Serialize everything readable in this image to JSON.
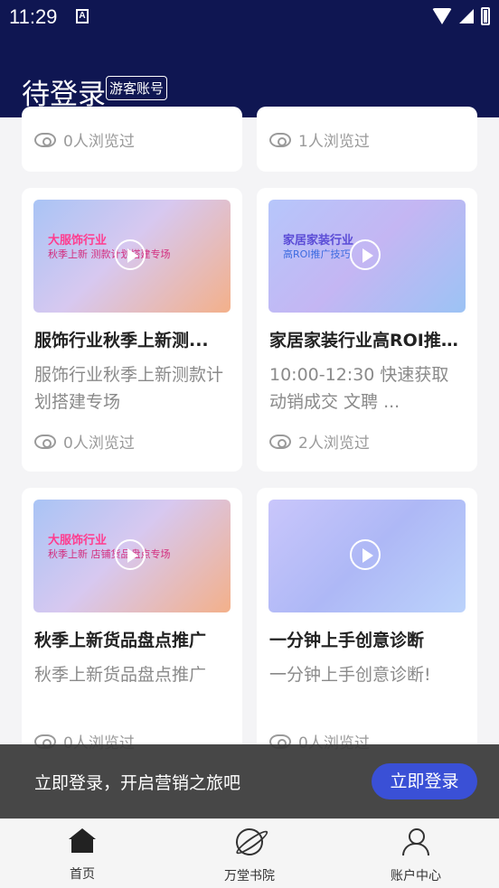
{
  "status_bar": {
    "time": "11:29",
    "a_label": "A"
  },
  "header": {
    "title": "待登录",
    "badge": "游客账号"
  },
  "top_row": [
    {
      "views": "0人浏览过"
    },
    {
      "views": "1人浏览过"
    }
  ],
  "cards": [
    {
      "thumb_line1": "大服饰行业",
      "thumb_line2": "秋季上新 测款计划搭建专场",
      "title": "服饰行业秋季上新测...",
      "desc": "服饰行业秋季上新测款计划搭建专场",
      "views": "0人浏览过"
    },
    {
      "thumb_line1": "家居家装行业",
      "thumb_line2": "高ROI推广技巧",
      "title": "家居家装行业高ROI推...",
      "desc": "10:00-12:30 快速获取动销成交 文聘 ...",
      "views": "2人浏览过"
    },
    {
      "thumb_line1": "大服饰行业",
      "thumb_line2": "秋季上新 店铺货品盘点专场",
      "title": "秋季上新货品盘点推广",
      "desc": "秋季上新货品盘点推广",
      "views": "0人浏览过"
    },
    {
      "thumb_line1": "",
      "thumb_line2": "",
      "title": "一分钟上手创意诊断",
      "desc": "一分钟上手创意诊断!",
      "views": "0人浏览过"
    }
  ],
  "login_banner": {
    "text": "立即登录，开启营销之旅吧",
    "button": "立即登录"
  },
  "bottom_nav": [
    {
      "label": "首页"
    },
    {
      "label": "万堂书院"
    },
    {
      "label": "账户中心"
    }
  ],
  "colors": {
    "header_bg": "#0f1652",
    "button_blue": "#3a50d6"
  }
}
